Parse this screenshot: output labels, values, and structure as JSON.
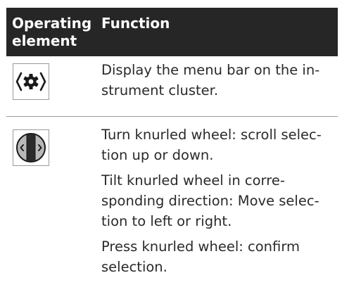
{
  "table": {
    "header": {
      "col1": "Operating element",
      "col2": "Function"
    },
    "rows": [
      {
        "icon": "settings-gear-icon",
        "paragraphs": [
          "Display the menu bar on the in-strument cluster."
        ]
      },
      {
        "icon": "knurled-wheel-icon",
        "paragraphs": [
          "Turn knurled wheel: scroll selec-tion up or down.",
          "Tilt knurled wheel in corre-sponding direction: Move selec-tion to left or right.",
          "Press knurled wheel: confirm selection."
        ]
      }
    ]
  },
  "colors": {
    "header_bg": "#262626",
    "header_text": "#ffffff",
    "body_text": "#2a2a2a",
    "rule": "#9a9a9a"
  }
}
